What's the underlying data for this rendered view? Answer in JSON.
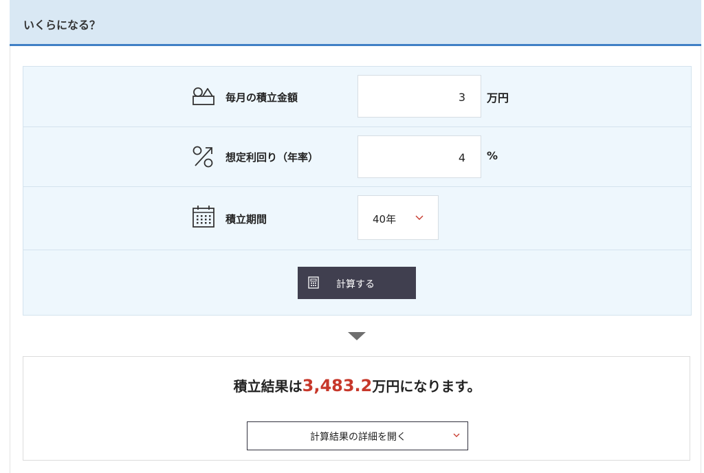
{
  "header": {
    "title": "いくらになる？"
  },
  "form": {
    "monthly": {
      "icon": "piggy-bank-icon",
      "label": "毎月の積立金額",
      "value": "3",
      "unit": "万円"
    },
    "rate": {
      "icon": "percent-icon",
      "label": "想定利回り（年率）",
      "value": "4",
      "unit": "%"
    },
    "period": {
      "icon": "calendar-icon",
      "label": "積立期間",
      "selected": "40年"
    },
    "calc_button": {
      "icon": "calculator-icon",
      "label": "計算する"
    }
  },
  "result": {
    "prefix": "積立結果は",
    "amount": "3,483.2",
    "suffix": "万円になります。",
    "detail_button": "計算結果の詳細を開く"
  },
  "colors": {
    "header_bg": "#d9e8f4",
    "header_border": "#3f7fc5",
    "panel_bg": "#eef7fd",
    "button_bg": "#403f4f",
    "accent_red": "#c7382b"
  }
}
